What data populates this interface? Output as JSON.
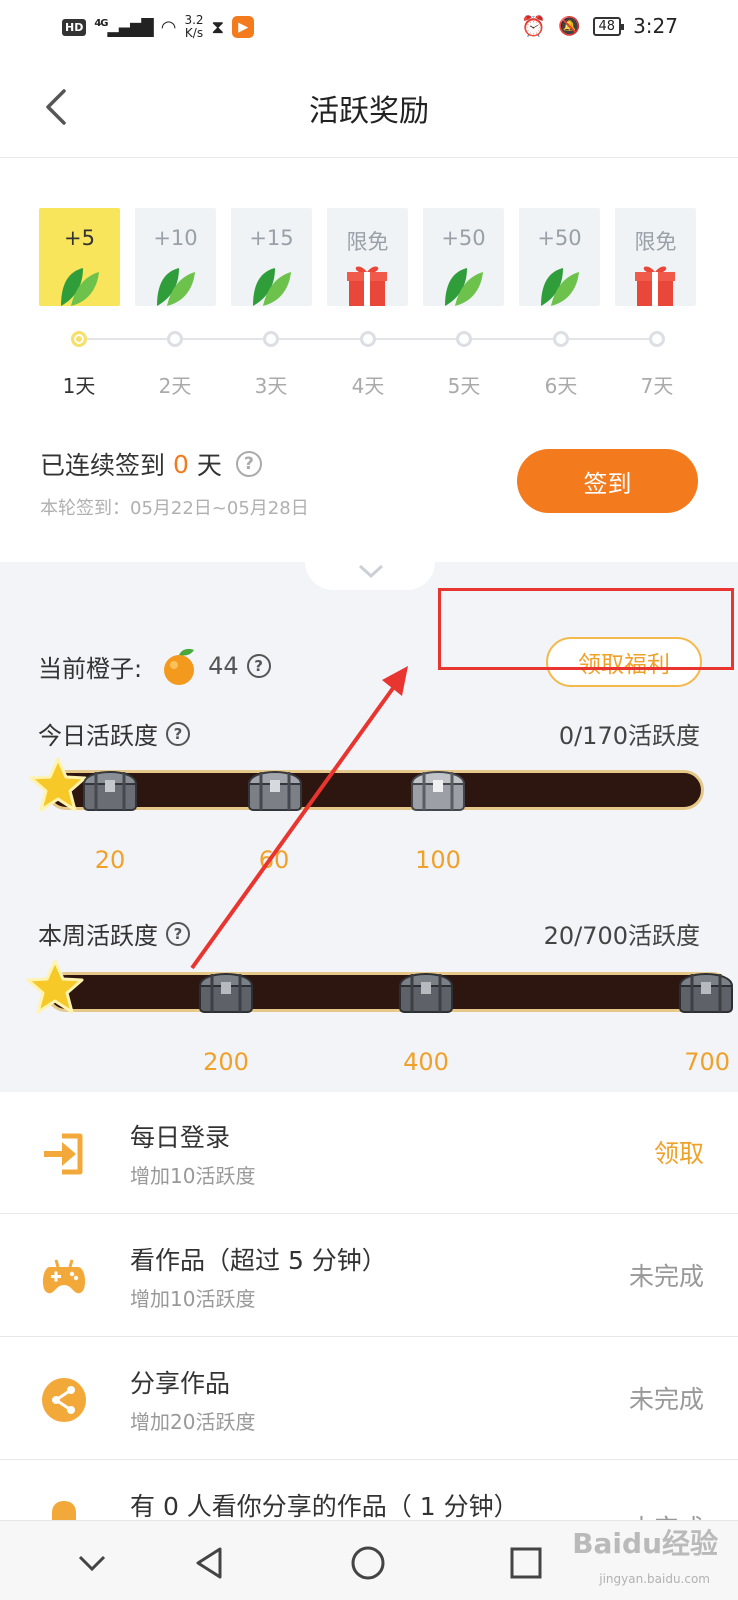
{
  "status_bar": {
    "hd": "HD",
    "network": "4G",
    "speed_value": "3.2",
    "speed_unit": "K/s",
    "battery": "48",
    "time": "3:27"
  },
  "nav": {
    "title": "活跃奖励"
  },
  "days": [
    {
      "value": "+5",
      "label": "1天",
      "icon": "leaf-icon",
      "active": true
    },
    {
      "value": "+10",
      "label": "2天",
      "icon": "leaf-icon",
      "active": false
    },
    {
      "value": "+15",
      "label": "3天",
      "icon": "leaf-icon",
      "active": false
    },
    {
      "value": "限免",
      "label": "4天",
      "icon": "gift-icon",
      "active": false
    },
    {
      "value": "+50",
      "label": "5天",
      "icon": "leaf-icon",
      "active": false
    },
    {
      "value": "+50",
      "label": "6天",
      "icon": "leaf-icon",
      "active": false
    },
    {
      "value": "限免",
      "label": "7天",
      "icon": "gift-icon",
      "active": false
    }
  ],
  "streak": {
    "prefix": "已连续签到",
    "count": "0",
    "suffix": "天",
    "round": "本轮签到：05月22日~05月28日",
    "button": "签到"
  },
  "oranges": {
    "label": "当前橙子:",
    "count": "44",
    "welfare_button": "领取福利"
  },
  "today": {
    "label": "今日活跃度",
    "value": "0/170活跃度",
    "progress": 0,
    "milestones": [
      "20",
      "60",
      "100"
    ]
  },
  "week": {
    "label": "本周活跃度",
    "value": "20/700活跃度",
    "progress": 0.0286,
    "milestones": [
      "200",
      "400",
      "700"
    ]
  },
  "tasks": [
    {
      "title": "每日登录",
      "sub": "增加10活跃度",
      "action": "领取",
      "icon": "login-icon"
    },
    {
      "title": "看作品（超过 5 分钟）",
      "sub": "增加10活跃度",
      "action": "未完成",
      "icon": "gamepad-icon"
    },
    {
      "title": "分享作品",
      "sub": "增加20活跃度",
      "action": "未完成",
      "icon": "share-icon"
    },
    {
      "title": "有 0 人看你分享的作品（ 1 分钟）",
      "sub": "",
      "action": "未完成",
      "icon": "bell-icon"
    }
  ],
  "watermark": {
    "brand": "Baidu经验",
    "url": "jingyan.baidu.com"
  },
  "colors": {
    "accent": "#f47a1e",
    "gold": "#f0a12a",
    "highlight": "#f9e55b",
    "annotation": "#e8352f"
  }
}
